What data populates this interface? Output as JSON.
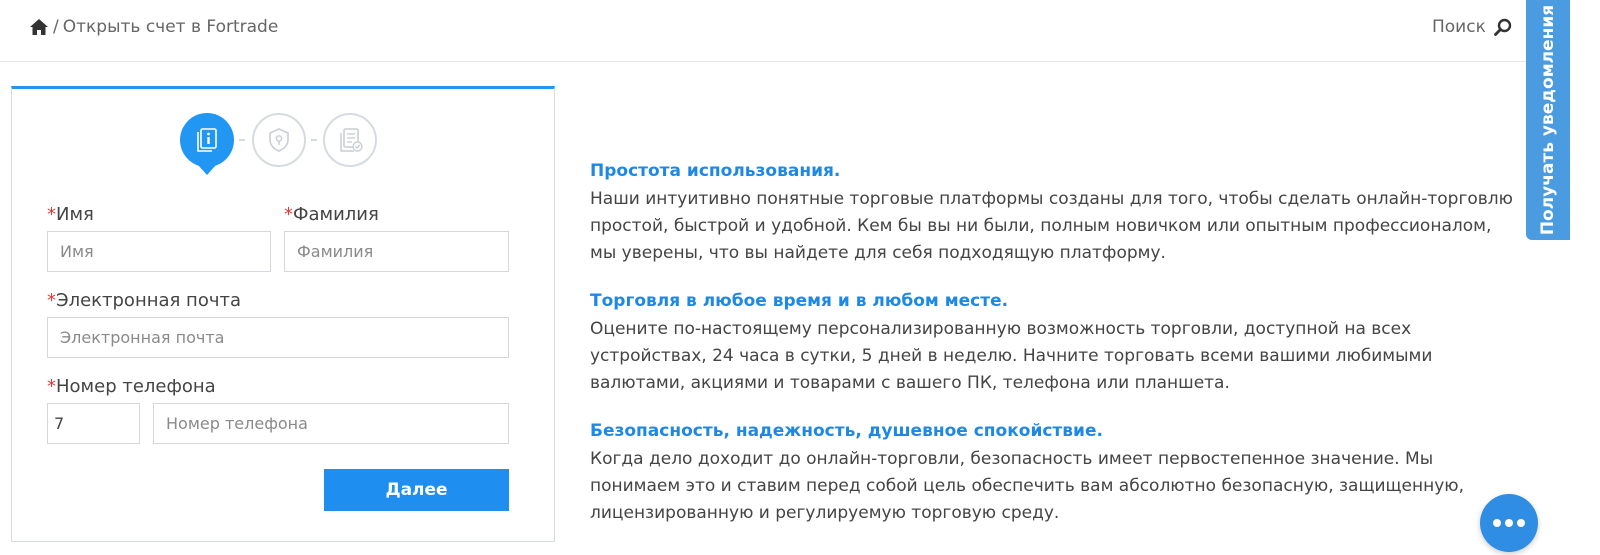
{
  "header": {
    "breadcrumb_sep": "/",
    "breadcrumb_current": "Открыть счет в Fortrade",
    "search_label": "Поиск"
  },
  "form": {
    "required_mark": "*",
    "first_name": {
      "label": "Имя",
      "placeholder": "Имя"
    },
    "last_name": {
      "label": "Фамилия",
      "placeholder": "Фамилия"
    },
    "email": {
      "label": "Электронная почта",
      "placeholder": "Электронная почта"
    },
    "phone": {
      "label": "Номер телефона",
      "code_value": "7",
      "placeholder": "Номер телефона"
    },
    "next_button": "Далее",
    "steps": [
      {
        "icon": "info-document-icon",
        "state": "active"
      },
      {
        "icon": "shield-lock-icon",
        "state": "inactive"
      },
      {
        "icon": "document-check-icon",
        "state": "inactive"
      }
    ]
  },
  "sections": [
    {
      "title": "Простота использования.",
      "text": "Наши интуитивно понятные торговые платформы созданы для того, чтобы сделать онлайн-торговлю\nпростой, быстрой и удобной. Кем бы вы ни были, полным новичком или опытным профессионалом,\nмы уверены, что вы найдете для себя подходящую платформу."
    },
    {
      "title": "Торговля в любое время и в любом месте.",
      "text": "Оцените по-настоящему персонализированную возможность торговли, доступной на всех\nустройствах, 24 часа в сутки, 5 дней в неделю. Начните торговать всеми вашими любимыми\nвалютами, акциями и товарами с вашего ПК, телефона или планшета."
    },
    {
      "title": "Безопасность, надежность, душевное спокойствие.",
      "text": "Когда дело доходит до онлайн-торговли, безопасность имеет первостепенное значение. Мы\nпонимаем это и ставим перед собой цель обеспечить вам абсолютно безопасную, защищенную,\nлицензированную и регулируемую торговую среду."
    }
  ],
  "notify_tab_label": "Получать уведомления",
  "colors": {
    "accent": "#2196f3",
    "required": "#e53935",
    "heading": "#1e88e5"
  }
}
